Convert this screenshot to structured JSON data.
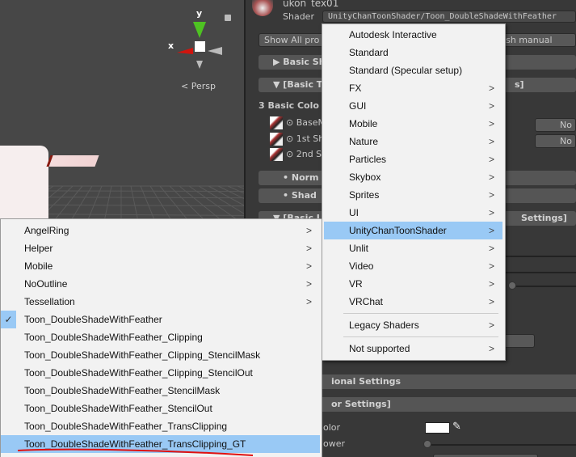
{
  "scene": {
    "gizmo_y": "y",
    "gizmo_x": "x",
    "projection_label": "Persp",
    "colors": {
      "x_axis": "#d0140e",
      "y_axis": "#4ec222",
      "background": "#474747"
    }
  },
  "inspector": {
    "material_name": "ukon_tex01",
    "shader_label": "Shader",
    "shader_value": "UnityChanToonShader/Toon_DoubleShadeWithFeather",
    "show_all_button": "Show All pro",
    "manual_button": "lish manual",
    "sections": {
      "basic_shader": "Basic Sha",
      "basic_three": "[Basic Th",
      "basic_three_end": "s]",
      "basic_colors": "3 Basic Colo",
      "base_map": "BaseM",
      "first_shade": "1st Sh",
      "second_shade": "2nd S",
      "no_sel_1": "No S",
      "no_sel_2": "No S",
      "normal": "• Norm",
      "shadow": "• Shad",
      "basic_light": "[Basic Li",
      "basic_light_end": "Settings]",
      "optional": "ional Settings",
      "color_settings": "or Settings]",
      "color_label": "olor",
      "power_label": "ower"
    },
    "colors": {
      "swatch": "#ffffff"
    }
  },
  "shader_menu": {
    "items": [
      {
        "label": "Autodesk Interactive",
        "submenu": false
      },
      {
        "label": "Standard",
        "submenu": false
      },
      {
        "label": "Standard (Specular setup)",
        "submenu": false
      },
      {
        "label": "FX",
        "submenu": true
      },
      {
        "label": "GUI",
        "submenu": true
      },
      {
        "label": "Mobile",
        "submenu": true
      },
      {
        "label": "Nature",
        "submenu": true
      },
      {
        "label": "Particles",
        "submenu": true
      },
      {
        "label": "Skybox",
        "submenu": true
      },
      {
        "label": "Sprites",
        "submenu": true
      },
      {
        "label": "UI",
        "submenu": true
      },
      {
        "label": "UnityChanToonShader",
        "submenu": true,
        "highlighted": true
      },
      {
        "label": "Unlit",
        "submenu": true
      },
      {
        "label": "Video",
        "submenu": true
      },
      {
        "label": "VR",
        "submenu": true
      },
      {
        "label": "VRChat",
        "submenu": true
      }
    ],
    "legacy": "Legacy Shaders",
    "not_supported": "Not supported",
    "arrow": ">"
  },
  "sub_menu": {
    "items": [
      {
        "label": "AngelRing",
        "submenu": true
      },
      {
        "label": "Helper",
        "submenu": true
      },
      {
        "label": "Mobile",
        "submenu": true
      },
      {
        "label": "NoOutline",
        "submenu": true
      },
      {
        "label": "Tessellation",
        "submenu": true
      },
      {
        "label": "Toon_DoubleShadeWithFeather",
        "checked": true
      },
      {
        "label": "Toon_DoubleShadeWithFeather_Clipping"
      },
      {
        "label": "Toon_DoubleShadeWithFeather_Clipping_StencilMask"
      },
      {
        "label": "Toon_DoubleShadeWithFeather_Clipping_StencilOut"
      },
      {
        "label": "Toon_DoubleShadeWithFeather_StencilMask"
      },
      {
        "label": "Toon_DoubleShadeWithFeather_StencilOut"
      },
      {
        "label": "Toon_DoubleShadeWithFeather_TransClipping"
      },
      {
        "label": "Toon_DoubleShadeWithFeather_TransClipping_GT",
        "highlighted": true
      }
    ],
    "check": "✓",
    "colors": {
      "highlight": "#99c9f5",
      "annotation": "#e01010"
    }
  }
}
